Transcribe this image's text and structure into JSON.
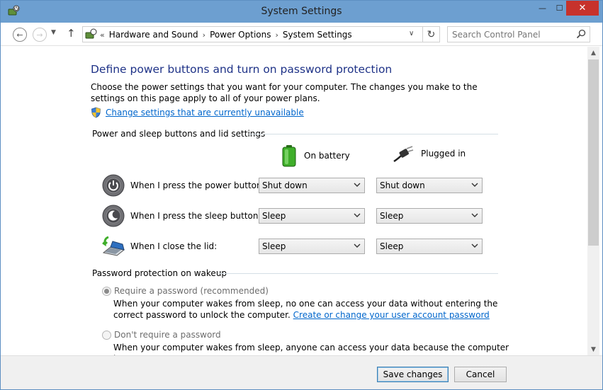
{
  "window": {
    "title": "System Settings"
  },
  "caption": {
    "minimize": "—",
    "maximize": "☐",
    "close": "✕"
  },
  "nav": {
    "back": "←",
    "forward": "→",
    "recent": "▼",
    "up": "↑",
    "breadcrumb_prefix": "«",
    "breadcrumbs": [
      "Hardware and Sound",
      "Power Options",
      "System Settings"
    ],
    "separator": "›",
    "address_dropdown": "∨",
    "refresh": "↻"
  },
  "search": {
    "placeholder": "Search Control Panel"
  },
  "page": {
    "heading": "Define power buttons and turn on password protection",
    "intro": "Choose the power settings that you want for your computer. The changes you make to the settings on this page apply to all of your power plans.",
    "change_settings_link": "Change settings that are currently unavailable"
  },
  "power_section": {
    "title": "Power and sleep buttons and lid settings",
    "columns": {
      "battery": "On battery",
      "plugged": "Plugged in"
    },
    "rows": [
      {
        "label": "When I press the power button:",
        "battery": "Shut down",
        "plugged": "Shut down"
      },
      {
        "label": "When I press the sleep button:",
        "battery": "Sleep",
        "plugged": "Sleep"
      },
      {
        "label": "When I close the lid:",
        "battery": "Sleep",
        "plugged": "Sleep"
      }
    ]
  },
  "password_section": {
    "title": "Password protection on wakeup",
    "require": {
      "label": "Require a password (recommended)",
      "description": "When your computer wakes from sleep, no one can access your data without entering the correct password to unlock the computer.",
      "link": "Create or change your user account password"
    },
    "no_require": {
      "label": "Don't require a password",
      "description": "When your computer wakes from sleep, anyone can access your data because the computer isn't"
    }
  },
  "scrollbar": {
    "up": "▲",
    "down": "▼"
  },
  "footer": {
    "save": "Save changes",
    "cancel": "Cancel"
  },
  "colors": {
    "titlebar": "#6d9fd0",
    "heading": "#1e3287",
    "link": "#0066cc",
    "close": "#c7322c"
  }
}
